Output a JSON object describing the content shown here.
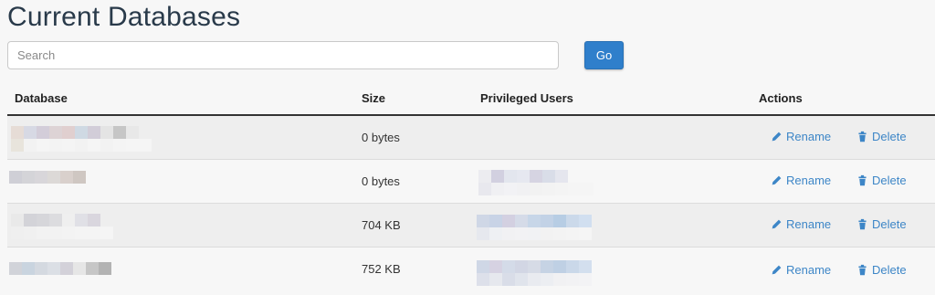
{
  "page": {
    "title": "Current Databases"
  },
  "search": {
    "placeholder": "Search",
    "value": "",
    "go_label": "Go"
  },
  "table": {
    "headers": {
      "database": "Database",
      "size": "Size",
      "users": "Privileged Users",
      "actions": "Actions"
    },
    "rows": [
      {
        "size": "0 bytes"
      },
      {
        "size": "0 bytes"
      },
      {
        "size": "704 KB"
      },
      {
        "size": "752 KB"
      }
    ],
    "rename_label": "Rename",
    "delete_label": "Delete"
  },
  "colors": {
    "accent": "#2f7fcb",
    "link": "#3d86c7",
    "title": "#293a4a"
  },
  "icons": {
    "rename": "pencil-icon",
    "delete": "trash-icon"
  }
}
